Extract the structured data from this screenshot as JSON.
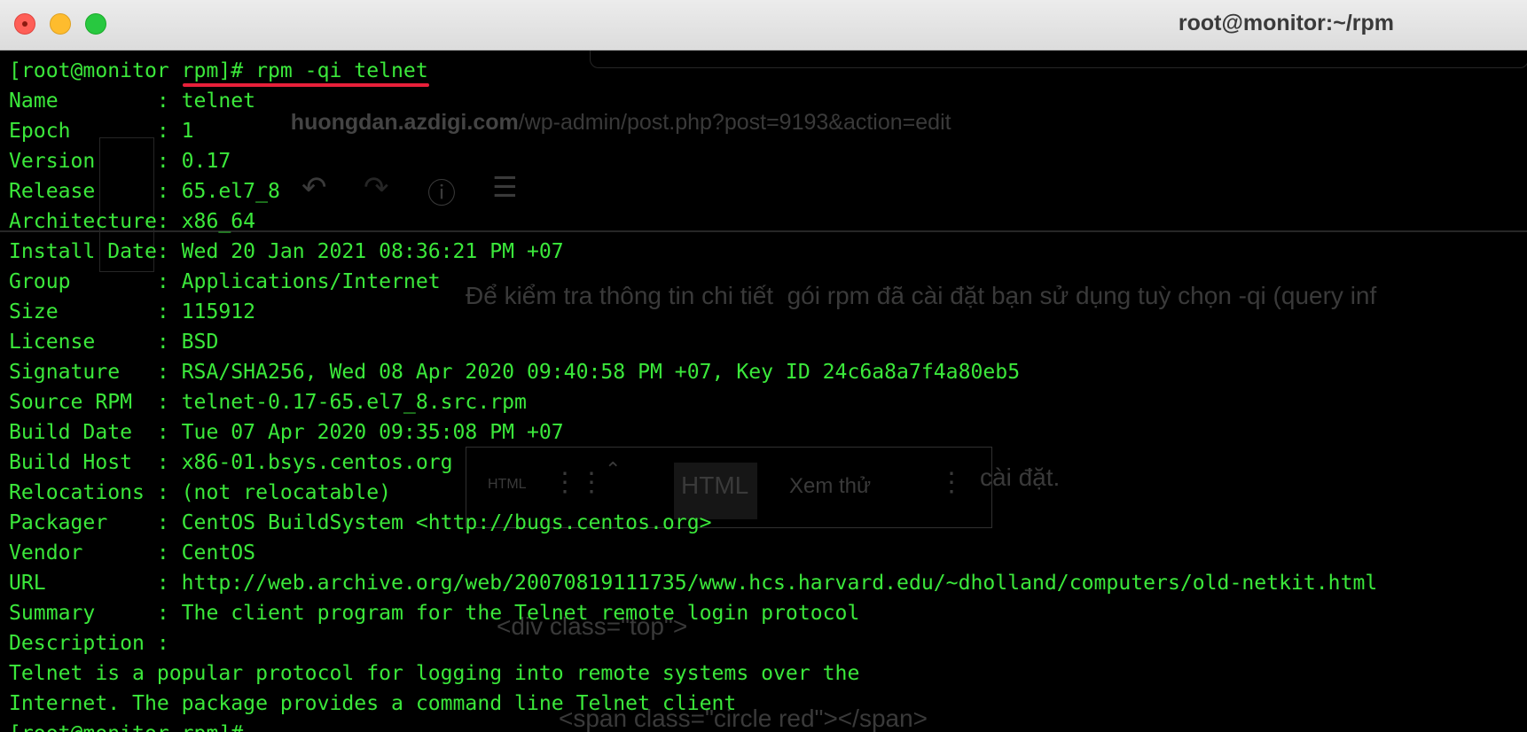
{
  "window": {
    "title": "root@monitor:~/rpm"
  },
  "background_ghost": {
    "url_domain": "huongdan.azdigi.com",
    "url_path": "/wp-admin/post.php?post=9193&action=edit",
    "paragraph": "Để kiểm tra thông tin chi tiết  gói rpm đã cài đặt bạn sử dụng tuỳ chọn -qi (query inf",
    "toolbar_html_small": "HTML",
    "toolbar_html": "HTML",
    "toolbar_preview": "Xem thử",
    "text_install": "cài đặt.",
    "code_line_1": "<div class=\"top\">",
    "code_line_2": "<span class=\"circle red\"></span>"
  },
  "terminal": {
    "command_prompt": "[root@monitor rpm]# rpm -qi telnet",
    "lines": [
      "Name        : telnet",
      "Epoch       : 1",
      "Version     : 0.17",
      "Release     : 65.el7_8",
      "Architecture: x86_64",
      "Install Date: Wed 20 Jan 2021 08:36:21 PM +07",
      "Group       : Applications/Internet",
      "Size        : 115912",
      "License     : BSD",
      "Signature   : RSA/SHA256, Wed 08 Apr 2020 09:40:58 PM +07, Key ID 24c6a8a7f4a80eb5",
      "Source RPM  : telnet-0.17-65.el7_8.src.rpm",
      "Build Date  : Tue 07 Apr 2020 09:35:08 PM +07",
      "Build Host  : x86-01.bsys.centos.org",
      "Relocations : (not relocatable)",
      "Packager    : CentOS BuildSystem <http://bugs.centos.org>",
      "Vendor      : CentOS",
      "URL         : http://web.archive.org/web/20070819111735/www.hcs.harvard.edu/~dholland/computers/old-netkit.html",
      "Summary     : The client program for the Telnet remote login protocol",
      "Description :",
      "Telnet is a popular protocol for logging into remote systems over the",
      "Internet. The package provides a command line Telnet client"
    ],
    "final_prompt": "[root@monitor rpm]#",
    "text_color": "#3be83b",
    "highlight_color": "#e8203a"
  }
}
